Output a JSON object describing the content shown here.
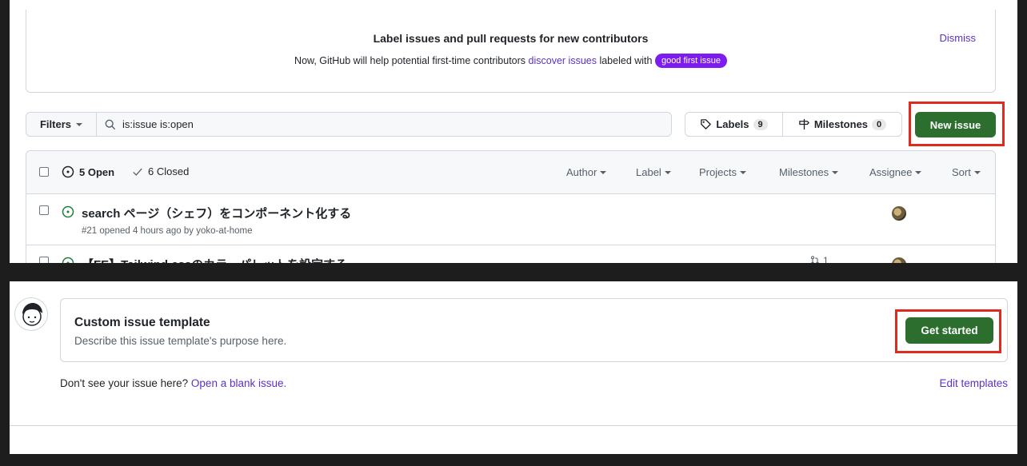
{
  "banner": {
    "title": "Label issues and pull requests for new contributors",
    "desc_prefix": "Now, GitHub will help potential first-time contributors ",
    "desc_link": "discover issues",
    "desc_mid": " labeled with ",
    "label_pill": "good first issue",
    "dismiss": "Dismiss"
  },
  "toolbar": {
    "filters_label": "Filters",
    "search_value": "is:issue is:open",
    "labels_label": "Labels",
    "labels_count": "9",
    "milestones_label": "Milestones",
    "milestones_count": "0",
    "new_issue_label": "New issue"
  },
  "issues_header": {
    "open_label": "5 Open",
    "closed_label": "6 Closed",
    "filters": [
      "Author",
      "Label",
      "Projects",
      "Milestones",
      "Assignee",
      "Sort"
    ]
  },
  "issues": [
    {
      "title": "search ページ（シェフ）をコンポーネント化する",
      "meta": "#21 opened 4 hours ago by yoko-at-home"
    },
    {
      "title": "【FE】Tailwind cssのカラーパレットを設定する",
      "pr_count": "1"
    }
  ],
  "template": {
    "name": "Custom issue template",
    "description": "Describe this issue template's purpose here.",
    "get_started": "Get started",
    "blank_prefix": "Don't see your issue here? ",
    "blank_link": "Open a blank issue.",
    "edit_templates": "Edit templates"
  },
  "colors": {
    "accent_link": "#5a32c8",
    "primary_button": "#2c6e2e",
    "highlight_box": "#e02a1e",
    "label_pill": "#7c1cf0"
  }
}
